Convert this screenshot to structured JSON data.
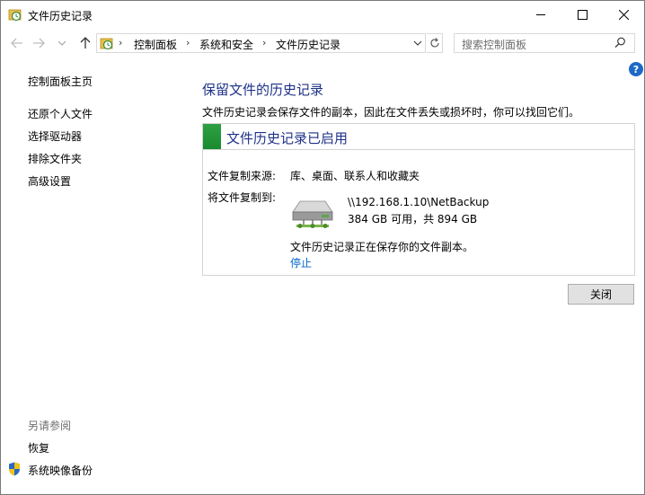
{
  "window": {
    "title": "文件历史记录"
  },
  "address": {
    "crumbs": [
      "控制面板",
      "系统和安全",
      "文件历史记录"
    ],
    "search_placeholder": "搜索控制面板"
  },
  "sidebar": {
    "home": "控制面板主页",
    "items": [
      "还原个人文件",
      "选择驱动器",
      "排除文件夹",
      "高级设置"
    ],
    "see_also_title": "另请参阅",
    "see_also": [
      "恢复",
      "系统映像备份"
    ]
  },
  "main": {
    "heading": "保留文件的历史记录",
    "description": "文件历史记录会保存文件的副本，因此在文件丢失或损坏时，你可以找回它们。",
    "status": "文件历史记录已启用",
    "status_color": "#2ea043",
    "source_label": "文件复制来源:",
    "source_value": "库、桌面、联系人和收藏夹",
    "dest_label": "将文件复制到:",
    "dest_path": "\\\\192.168.1.10\\NetBackup",
    "dest_space": "384 GB 可用，共 894 GB",
    "saving_text": "文件历史记录正在保存你的文件副本。",
    "stop_link": "停止",
    "close_button": "关闭"
  }
}
